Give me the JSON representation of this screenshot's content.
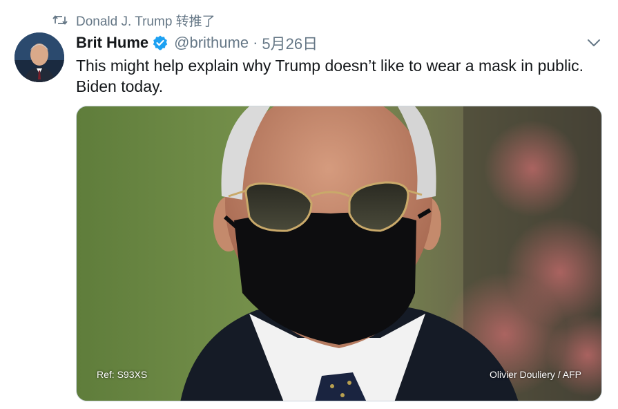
{
  "retweet": {
    "icon": "retweet-icon",
    "text": "Donald J. Trump 转推了"
  },
  "author": {
    "name": "Brit Hume",
    "verified": true,
    "handle": "@brithume",
    "separator": "·",
    "date": "5月26日"
  },
  "tweet": {
    "text": "This might help explain why Trump doesn’t like to wear a mask in public. Biden today."
  },
  "media": {
    "caption_left": "Ref: S93XS",
    "caption_right": "Olivier Douliery / AFP"
  },
  "colors": {
    "verified": "#1da1f2",
    "secondary_text": "#657786",
    "primary_text": "#14171a"
  },
  "icons": {
    "caret": "chevron-down-icon",
    "verified": "verified-badge-icon"
  }
}
